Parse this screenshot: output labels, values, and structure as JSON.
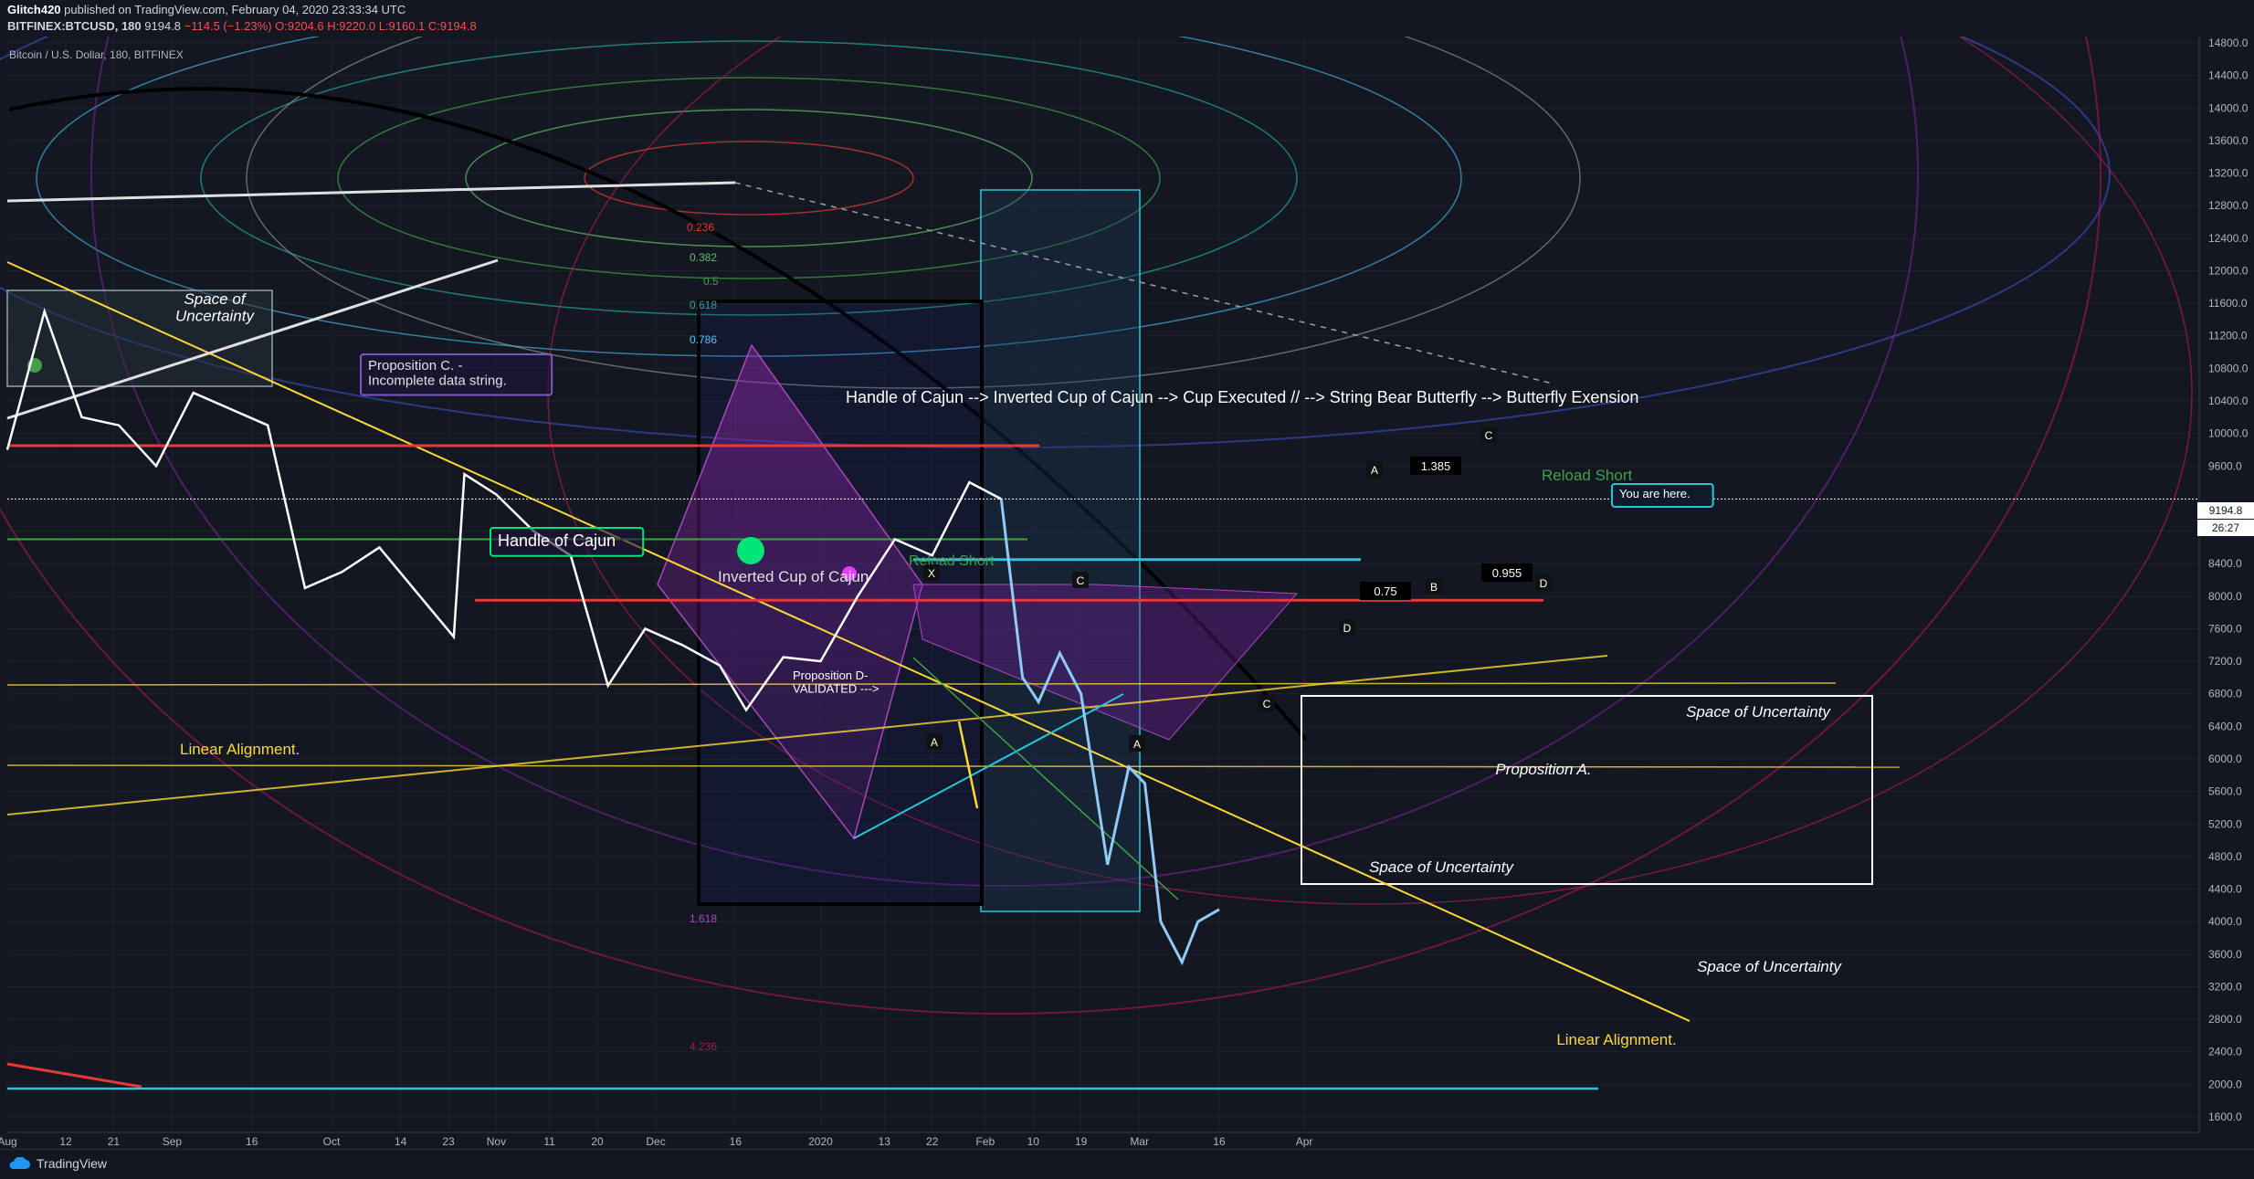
{
  "header": {
    "author": "Glitch420",
    "published": "published on TradingView.com, February 04, 2020 23:33:34 UTC",
    "symbol_line": "BITFINEX:BTCUSD, 180",
    "last": "9194.8",
    "change": "−114.5 (−1.23%)",
    "open": "O:9204.6",
    "high": "H:9220.0",
    "low": "L:9160.1",
    "close": "C:9194.8"
  },
  "legend_title": "Bitcoin / U.S. Dollar, 180, BITFINEX",
  "last_price_tag": "9194.8",
  "countdown_tag": "26:27",
  "footer": {
    "brand": "TradingView"
  },
  "chart_data": {
    "type": "line",
    "title": "Bitcoin / U.S. Dollar, 180, BITFINEX",
    "ylim": [
      1500,
      15000
    ],
    "y_ticks": [
      "14800.0",
      "14400.0",
      "14000.0",
      "13600.0",
      "13200.0",
      "12800.0",
      "12400.0",
      "12000.0",
      "11600.0",
      "11200.0",
      "10800.0",
      "10400.0",
      "10000.0",
      "9600.0",
      "8800.0",
      "8400.0",
      "8000.0",
      "7600.0",
      "7200.0",
      "6800.0",
      "6400.0",
      "6000.0",
      "5600.0",
      "5200.0",
      "4800.0",
      "4400.0",
      "4000.0",
      "3600.0",
      "3200.0",
      "2800.0",
      "2400.0",
      "2000.0",
      "1600.0"
    ],
    "x_ticks": [
      "Aug",
      "12",
      "21",
      "Sep",
      "16",
      "Oct",
      "14",
      "23",
      "Nov",
      "11",
      "20",
      "Dec",
      "16",
      "2020",
      "13",
      "22",
      "Feb",
      "10",
      "19",
      "Mar",
      "16",
      "Apr"
    ],
    "price_series": {
      "name": "BTCUSD",
      "dates": [
        "2019-08-01",
        "2019-08-08",
        "2019-08-15",
        "2019-08-22",
        "2019-08-29",
        "2019-09-05",
        "2019-09-12",
        "2019-09-19",
        "2019-09-26",
        "2019-10-03",
        "2019-10-10",
        "2019-10-17",
        "2019-10-24",
        "2019-10-26",
        "2019-11-01",
        "2019-11-08",
        "2019-11-15",
        "2019-11-22",
        "2019-11-29",
        "2019-12-06",
        "2019-12-13",
        "2019-12-18",
        "2019-12-25",
        "2020-01-01",
        "2020-01-08",
        "2020-01-15",
        "2020-01-22",
        "2020-01-29",
        "2020-02-04"
      ],
      "values": [
        9800,
        11500,
        10200,
        10100,
        9600,
        10500,
        10300,
        10100,
        8100,
        8300,
        8600,
        8050,
        7500,
        9500,
        9250,
        8800,
        8500,
        6900,
        7600,
        7400,
        7150,
        6600,
        7250,
        7200,
        8000,
        8700,
        8500,
        9400,
        9194.8
      ]
    },
    "projection_series": {
      "name": "projection",
      "dates": [
        "2020-02-08",
        "2020-02-11",
        "2020-02-15",
        "2020-02-19",
        "2020-02-24",
        "2020-02-28",
        "2020-03-02",
        "2020-03-05",
        "2020-03-09",
        "2020-03-12",
        "2020-03-16"
      ],
      "values": [
        7000,
        6700,
        7300,
        6800,
        4700,
        5900,
        5700,
        4000,
        3500,
        4000,
        4150
      ]
    },
    "levels": [
      {
        "name": "red",
        "value": 9850
      },
      {
        "name": "red",
        "value": 7950
      },
      {
        "name": "green",
        "value": 8700
      },
      {
        "name": "cyan",
        "value": 8450
      },
      {
        "name": "white",
        "value": 9194.8
      }
    ],
    "fib_labels": [
      "0.236",
      "0.382",
      "0.5",
      "0.618",
      "0.786",
      "1.618",
      "4.236"
    ],
    "annotations": [
      "Space of\nUncertainty",
      "Proposition C. -\nIncomplete data string.",
      "Handle of Cajun",
      "Inverted Cup of Cajun",
      "Reload Short",
      "Reload Short",
      "Proposition D-\nVALIDATED --->",
      "Linear Alignment.",
      "Handle of Cajun --> Inverted Cup of Cajun --> Cup Executed // --> String Bear Butterfly --> Butterfly Exension",
      "You are here.",
      "Space of Uncertainty",
      "Proposition A.",
      "Space of Uncertainty",
      "Space of Uncertainty",
      "Linear Alignment."
    ],
    "pattern_labels": [
      "1.385",
      "0.75",
      "0.955",
      "A",
      "B",
      "C",
      "D",
      "X"
    ],
    "grid": true
  }
}
